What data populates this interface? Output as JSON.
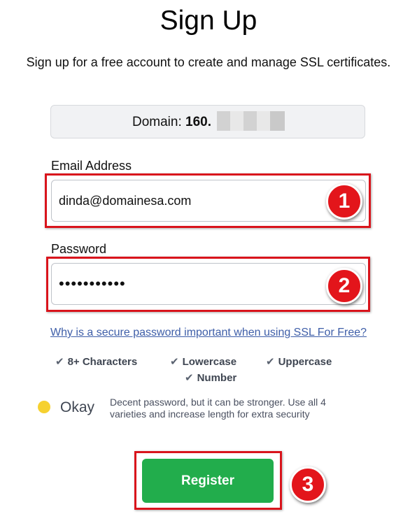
{
  "header": {
    "title": "Sign Up",
    "subtitle": "Sign up for a free account to create and manage SSL certificates."
  },
  "domain": {
    "label": "Domain:",
    "value": "160."
  },
  "email": {
    "label": "Email Address",
    "value": "dinda@domainesa.com"
  },
  "password": {
    "label": "Password",
    "masked_value": "•••••••••••"
  },
  "help_link": "Why is a secure password important when using SSL For Free?",
  "requirements": [
    {
      "icon": "check-icon",
      "label": "8+ Characters"
    },
    {
      "icon": "check-icon",
      "label": "Lowercase"
    },
    {
      "icon": "check-icon",
      "label": "Uppercase"
    },
    {
      "icon": "check-icon",
      "label": "Number"
    }
  ],
  "strength": {
    "label": "Okay",
    "message": "Decent password, but it can be stronger. Use all 4 varieties and increase length for extra security",
    "color": "#f6d130"
  },
  "register_label": "Register",
  "annotations": [
    "1",
    "2",
    "3"
  ],
  "colors": {
    "primary_button": "#22ad4c",
    "annotation_red": "#e3151b",
    "link": "#3e5ea8"
  }
}
